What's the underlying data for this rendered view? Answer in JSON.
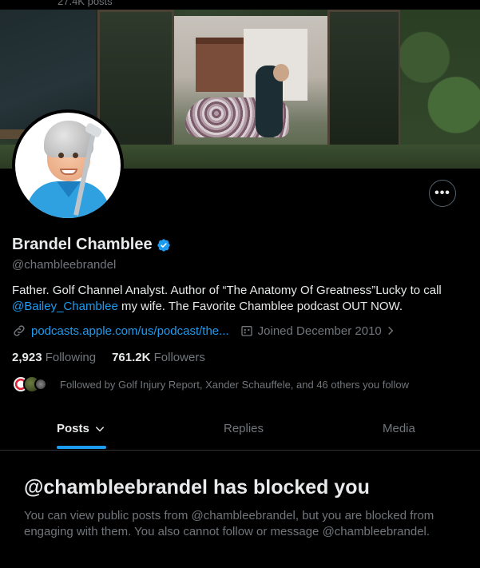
{
  "header": {
    "posts_count": "27.4K posts"
  },
  "profile": {
    "display_name": "Brandel Chamblee",
    "handle": "@chambleebrandel",
    "bio_part1": "Father. Golf Channel Analyst. Author of “The Anatomy Of Greatness”Lucky to call",
    "bio_mention": "@Bailey_Chamblee",
    "bio_part2": " my wife. The Favorite Chamblee podcast OUT NOW.",
    "website": "podcasts.apple.com/us/podcast/the...",
    "joined": "Joined December 2010",
    "following_count": "2,923",
    "following_label": "Following",
    "followers_count": "761.2K",
    "followers_label": "Followers",
    "followed_by": "Followed by Golf Injury Report, Xander Schauffele, and 46 others you follow"
  },
  "actions": {
    "more_label": "•••"
  },
  "tabs": [
    {
      "label": "Posts",
      "active": true
    },
    {
      "label": "Replies",
      "active": false
    },
    {
      "label": "Media",
      "active": false
    }
  ],
  "blocked": {
    "title": "@chambleebrandel has blocked you",
    "description": "You can view public posts from @chambleebrandel, but you are blocked from engaging with them. You also cannot follow or message @chambleebrandel."
  },
  "colors": {
    "accent": "#1d9bf0",
    "text": "#e7e9ea",
    "muted": "#71767b",
    "background": "#000000"
  },
  "icons": [
    "verified-badge-icon",
    "link-icon",
    "calendar-icon",
    "chevron-right-icon",
    "chevron-down-icon",
    "more-icon"
  ]
}
